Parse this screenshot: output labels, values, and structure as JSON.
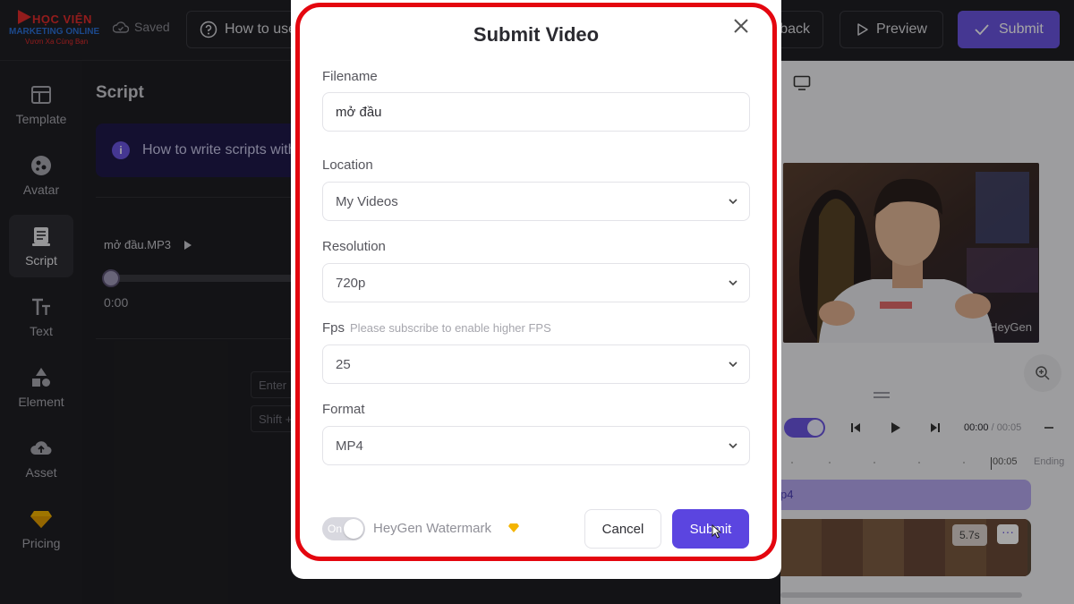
{
  "topbar": {
    "logo": {
      "line1": "HỌC VIỆN",
      "line2": "MARKETING ONLINE",
      "line3": "Vươn Xa Cùng Bạn"
    },
    "saved_label": "Saved",
    "howto_label": "How to use",
    "feedback_label": "back",
    "preview_label": "Preview",
    "submit_label": "Submit"
  },
  "sidebar": {
    "items": [
      {
        "label": "Template",
        "icon": "template-icon"
      },
      {
        "label": "Avatar",
        "icon": "avatar-icon"
      },
      {
        "label": "Script",
        "icon": "script-icon",
        "active": true
      },
      {
        "label": "Text",
        "icon": "text-icon"
      },
      {
        "label": "Element",
        "icon": "element-icon"
      },
      {
        "label": "Asset",
        "icon": "asset-icon"
      },
      {
        "label": "Pricing",
        "icon": "diamond-icon"
      }
    ]
  },
  "script_panel": {
    "title": "Script",
    "tip": "How to write scripts with",
    "audio_file": "mở đầu.MP3",
    "audio_time": "0:00",
    "hint_enter": "Enter",
    "hint_shift": "Shift +"
  },
  "timeline": {
    "current_time": "00:00",
    "total_time": " / 00:05",
    "ruler_mark": "00:05",
    "ending_label": "Ending",
    "audio_clip_label": "p4",
    "clip_duration": "5.7s",
    "more_label": "···",
    "watermark_text": "HeyGen"
  },
  "modal": {
    "title": "Submit Video",
    "filename_label": "Filename",
    "filename_value": "mở đầu",
    "location_label": "Location",
    "location_value": "My Videos",
    "resolution_label": "Resolution",
    "resolution_value": "720p",
    "fps_label": "Fps",
    "fps_hint": "Please subscribe to enable higher FPS",
    "fps_value": "25",
    "format_label": "Format",
    "format_value": "MP4",
    "watermark_toggle": "On",
    "watermark_label": "HeyGen Watermark",
    "cancel_label": "Cancel",
    "submit_label": "Submit"
  },
  "colors": {
    "accent": "#5b45e0",
    "highlight_outline": "#e4060f",
    "premium_gem": "#f4b400"
  }
}
